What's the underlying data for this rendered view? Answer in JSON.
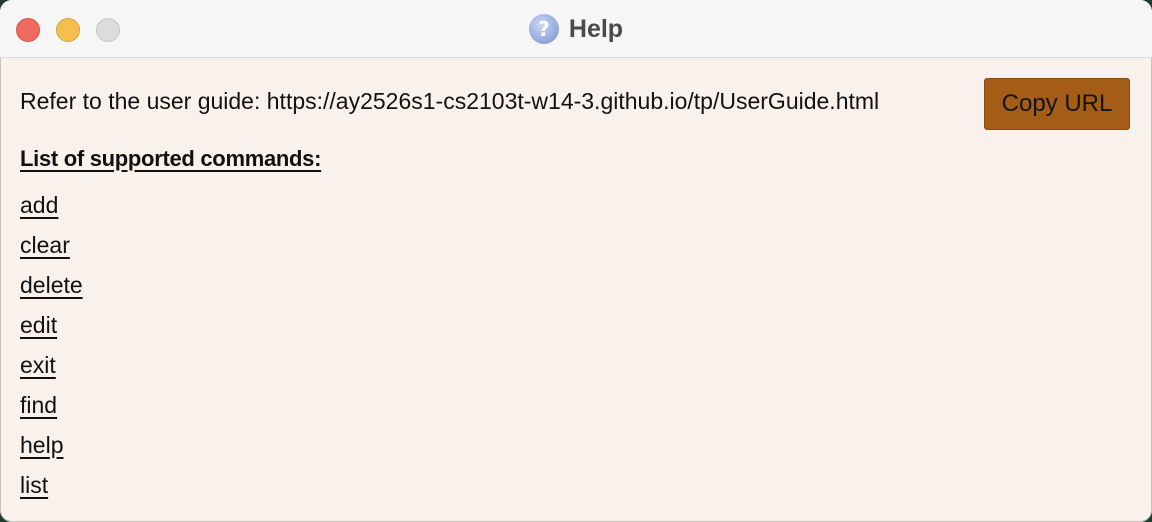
{
  "window": {
    "title": "Help",
    "icon": "help-question-icon"
  },
  "guide": {
    "text": "Refer to the user guide: https://ay2526s1-cs2103t-w14-3.github.io/tp/UserGuide.html",
    "copy_button_label": "Copy URL"
  },
  "commands": {
    "heading": "List of supported commands:",
    "items": [
      "add",
      "clear",
      "delete",
      "edit",
      "exit",
      "find",
      "help",
      "list"
    ]
  },
  "colors": {
    "background": "#f9f2ec",
    "copy_button": "#a45d16",
    "close": "#ee6a5f",
    "minimize": "#f5bf4f",
    "zoom_disabled": "#dcdcdc"
  }
}
